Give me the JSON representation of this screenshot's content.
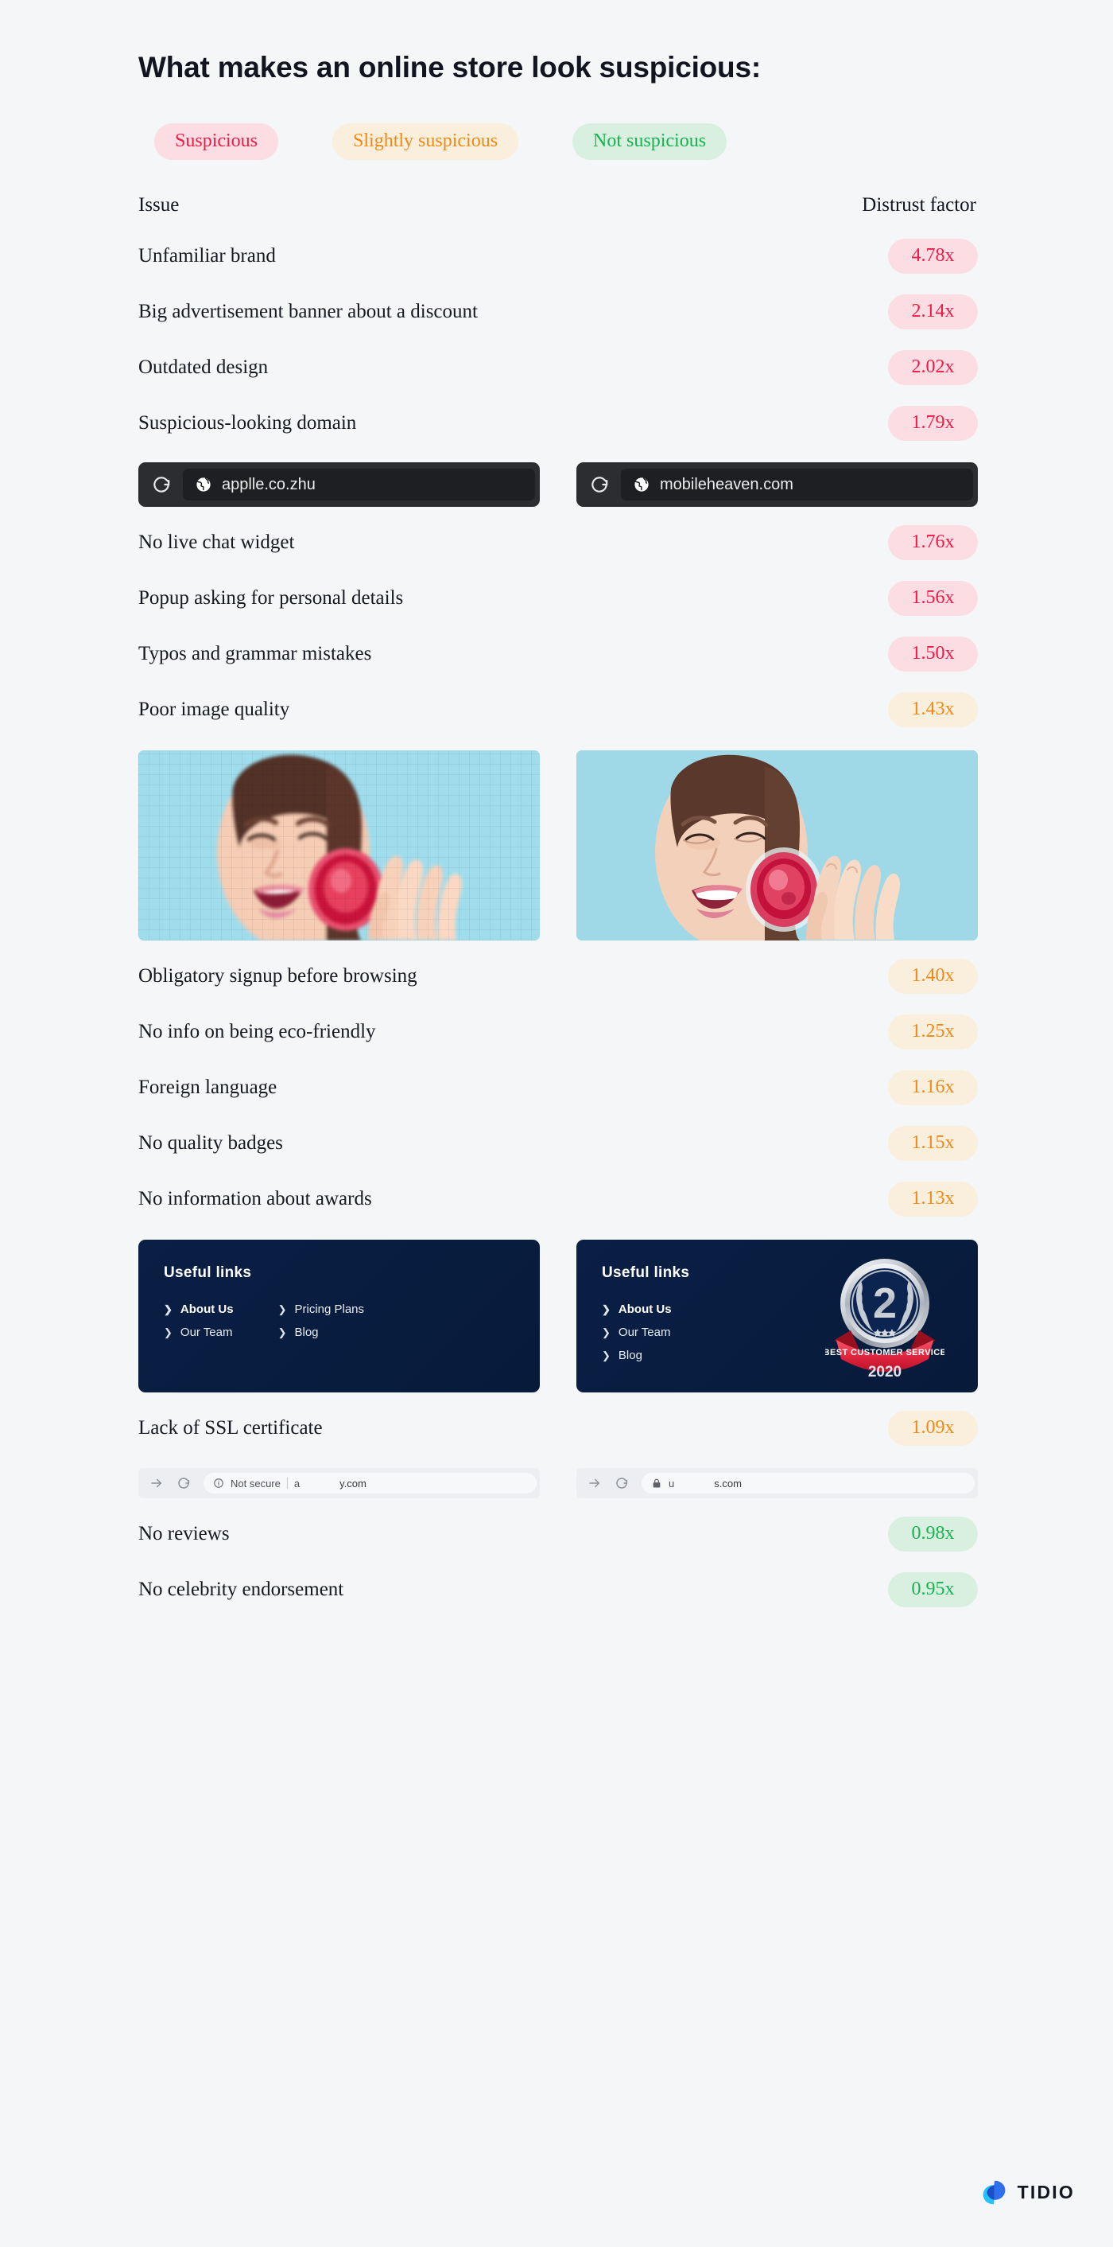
{
  "title": "What makes an online store look suspicious:",
  "legend": [
    {
      "label": "Suspicious",
      "color": "#f01b45",
      "bg": "#fbdde3"
    },
    {
      "label": "Slightly suspicious",
      "color": "#f08a15",
      "bg": "#faeedc"
    },
    {
      "label": "Not suspicious",
      "color": "#15b450",
      "bg": "#d9f0e1"
    }
  ],
  "table": {
    "header_issue": "Issue",
    "header_factor": "Distrust factor"
  },
  "rows": {
    "r1": {
      "label": "Unfamiliar brand",
      "value": "4.78x"
    },
    "r2": {
      "label": "Big advertisement banner about a discount",
      "value": "2.14x"
    },
    "r3": {
      "label": "Outdated design",
      "value": "2.02x"
    },
    "r4": {
      "label": "Suspicious-looking domain",
      "value": "1.79x"
    },
    "r5": {
      "label": "No live chat widget",
      "value": "1.76x"
    },
    "r6": {
      "label": "Popup asking for personal details",
      "value": "1.56x"
    },
    "r7": {
      "label": "Typos and grammar mistakes",
      "value": "1.50x"
    },
    "r8": {
      "label": "Poor image quality",
      "value": "1.43x"
    },
    "r9": {
      "label": "Obligatory signup before browsing",
      "value": "1.40x"
    },
    "r10": {
      "label": "No info on being eco-friendly",
      "value": "1.25x"
    },
    "r11": {
      "label": "Foreign language",
      "value": "1.16x"
    },
    "r12": {
      "label": "No quality badges",
      "value": "1.15x"
    },
    "r13": {
      "label": "No information about awards",
      "value": "1.13x"
    },
    "r14": {
      "label": "Lack of SSL certificate",
      "value": "1.09x"
    },
    "r15": {
      "label": "No reviews",
      "value": "0.98x"
    },
    "r16": {
      "label": "No celebrity endorsement",
      "value": "0.95x"
    }
  },
  "domain_example": {
    "bad_url": "applle.co.zhu",
    "good_url": "mobileheaven.com"
  },
  "footer_cards": {
    "left": {
      "title": "Useful  links",
      "col1": [
        "About Us",
        "Our Team"
      ],
      "col2": [
        "Pricing Plans",
        "Blog"
      ]
    },
    "right": {
      "title": "Useful  links",
      "links": [
        "About Us",
        "Our Team",
        "Blog"
      ],
      "badge": {
        "number": "2",
        "ribbon": "BEST CUSTOMER SERVICE",
        "year": "2020"
      }
    }
  },
  "ssl_example": {
    "insecure": {
      "warning": "Not secure",
      "prefix": "a",
      "host": "y.com"
    },
    "secure": {
      "prefix": "u",
      "host": "s.com"
    }
  },
  "brand": {
    "name": "TIDIO",
    "accent": "#2f6fed",
    "accent_light": "#22c3fb"
  },
  "chart_data": {
    "type": "bar",
    "title": "What makes an online store look suspicious:",
    "xlabel": "Issue",
    "ylabel": "Distrust factor",
    "unit": "x",
    "categories": [
      "Unfamiliar brand",
      "Big advertisement banner about a discount",
      "Outdated design",
      "Suspicious-looking domain",
      "No live chat widget",
      "Popup asking for personal details",
      "Typos and grammar mistakes",
      "Poor image quality",
      "Obligatory signup before browsing",
      "No info on being eco-friendly",
      "Foreign language",
      "No quality badges",
      "No information about awards",
      "Lack of SSL certificate",
      "No reviews",
      "No celebrity endorsement"
    ],
    "values": [
      4.78,
      2.14,
      2.02,
      1.79,
      1.76,
      1.56,
      1.5,
      1.43,
      1.4,
      1.25,
      1.16,
      1.15,
      1.13,
      1.09,
      0.98,
      0.95
    ],
    "categories_legend": [
      "Suspicious",
      "Suspicious",
      "Suspicious",
      "Suspicious",
      "Suspicious",
      "Suspicious",
      "Suspicious",
      "Slightly suspicious",
      "Slightly suspicious",
      "Slightly suspicious",
      "Slightly suspicious",
      "Slightly suspicious",
      "Slightly suspicious",
      "Slightly suspicious",
      "Not suspicious",
      "Not suspicious"
    ],
    "legend": [
      "Suspicious",
      "Slightly suspicious",
      "Not suspicious"
    ],
    "legend_position": "top",
    "grid": false
  }
}
